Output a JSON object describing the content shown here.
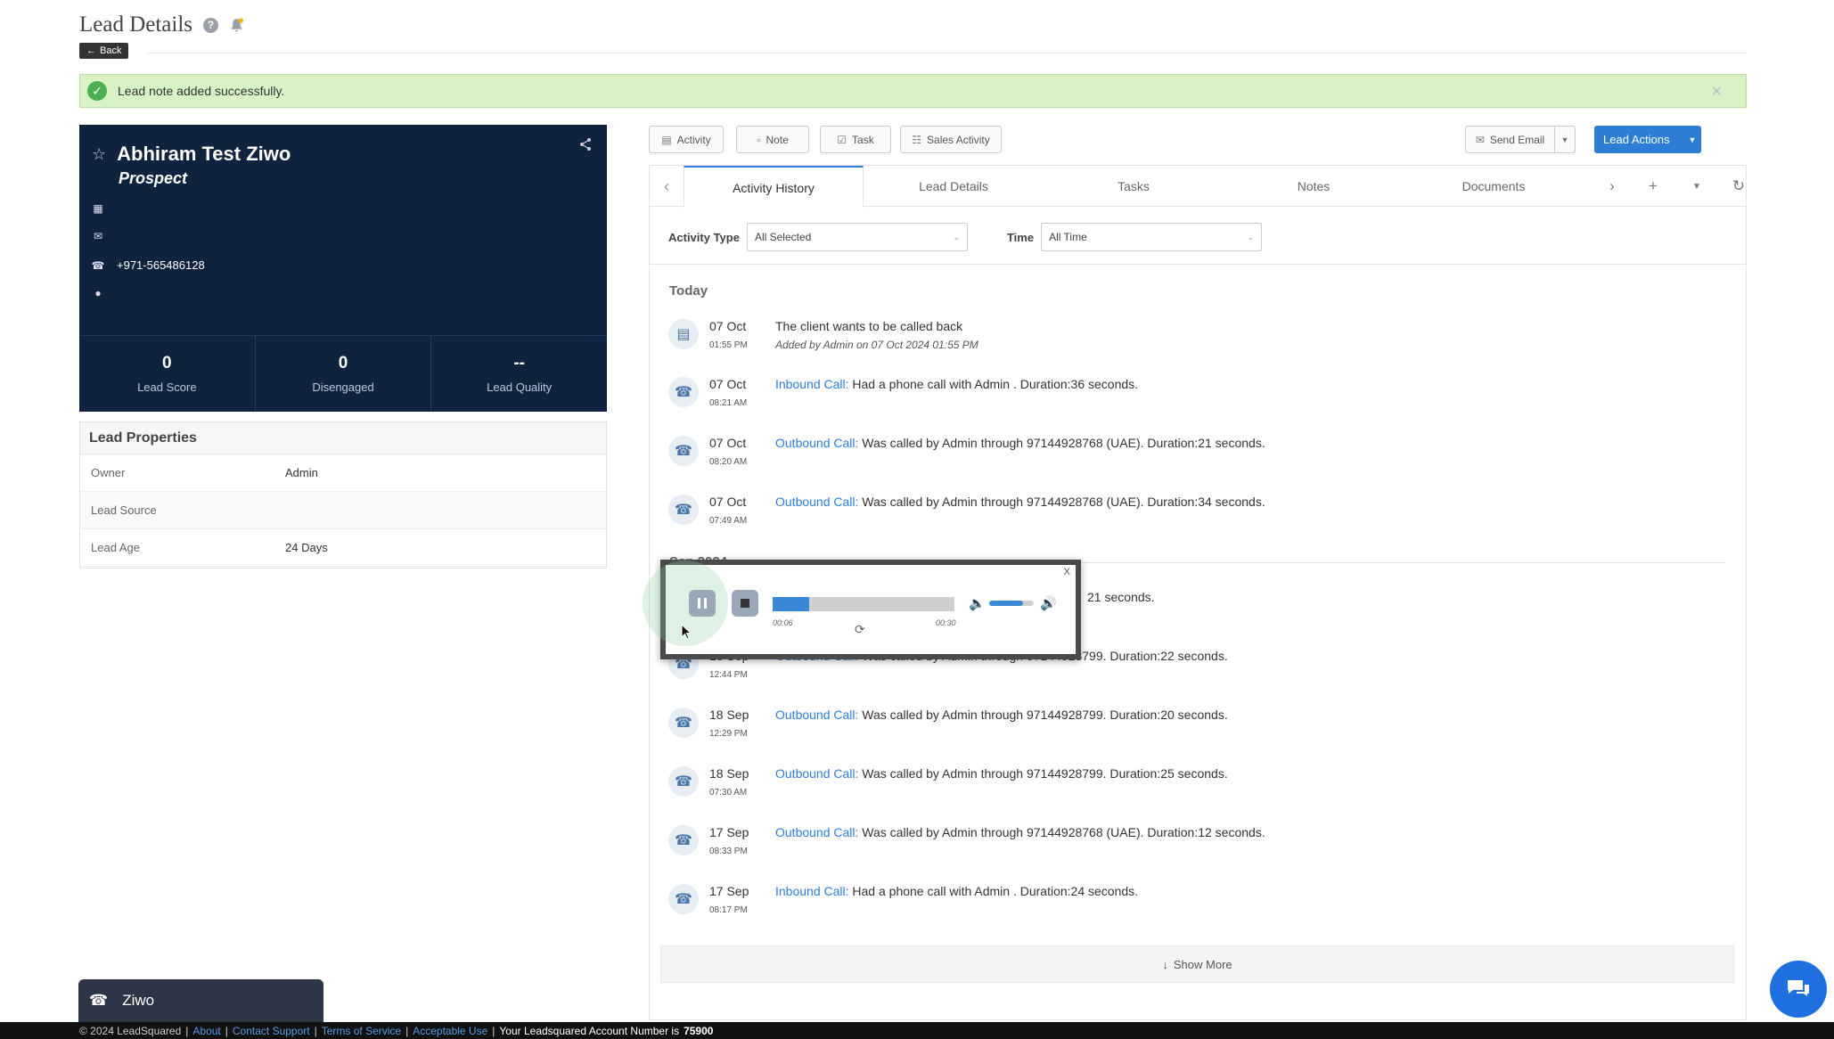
{
  "header": {
    "title": "Lead Details",
    "back_label": "Back"
  },
  "alert": {
    "message": "Lead note added successfully."
  },
  "lead": {
    "name": "Abhiram Test Ziwo",
    "status": "Prospect",
    "phone": "+971-565486128",
    "stats": [
      {
        "value": "0",
        "label": "Lead Score"
      },
      {
        "value": "0",
        "label": "Disengaged"
      },
      {
        "value": "--",
        "label": "Lead Quality"
      }
    ]
  },
  "properties": {
    "title": "Lead Properties",
    "rows": [
      {
        "key": "Owner",
        "value": "Admin"
      },
      {
        "key": "Lead Source",
        "value": ""
      },
      {
        "key": "Lead Age",
        "value": "24 Days"
      }
    ]
  },
  "toolbar": {
    "activity": "Activity",
    "note": "Note",
    "task": "Task",
    "sales_activity": "Sales Activity",
    "send_email": "Send Email",
    "lead_actions": "Lead Actions"
  },
  "tabs": [
    "Activity History",
    "Lead Details",
    "Tasks",
    "Notes",
    "Documents"
  ],
  "filters": {
    "activity_type_label": "Activity Type",
    "activity_type_value": "All Selected",
    "time_label": "Time",
    "time_value": "All Time"
  },
  "groups": {
    "today": "Today",
    "sep": "Sep 2024"
  },
  "activities": [
    {
      "date": "07 Oct",
      "time": "01:55 PM",
      "type": "",
      "text": "The client wants to be called back",
      "sub_prefix": "Added by",
      "sub_user": "Admin",
      "sub_on": "on",
      "sub_when": "07 Oct 2024 01:55 PM"
    },
    {
      "date": "07 Oct",
      "time": "08:21 AM",
      "type": "Inbound Call:",
      "text": "Had a phone call with Admin . Duration:36 seconds."
    },
    {
      "date": "07 Oct",
      "time": "08:20 AM",
      "type": "Outbound Call:",
      "text": "Was called by Admin through 97144928768 (UAE). Duration:21 seconds."
    },
    {
      "date": "07 Oct",
      "time": "07:49 AM",
      "type": "Outbound Call:",
      "text": "Was called by Admin through 97144928768 (UAE). Duration:34 seconds."
    },
    {
      "date": "",
      "time": "",
      "type": "",
      "text": "21 seconds."
    },
    {
      "date": "18 Sep",
      "time": "12:44 PM",
      "type": "Outbound Call:",
      "text": "Was called by Admin through 97144928799. Duration:22 seconds."
    },
    {
      "date": "18 Sep",
      "time": "12:29 PM",
      "type": "Outbound Call:",
      "text": "Was called by Admin through 97144928799. Duration:20 seconds."
    },
    {
      "date": "18 Sep",
      "time": "07:30 AM",
      "type": "Outbound Call:",
      "text": "Was called by Admin through 97144928799. Duration:25 seconds."
    },
    {
      "date": "17 Sep",
      "time": "08:33 PM",
      "type": "Outbound Call:",
      "text": "Was called by Admin through 97144928768 (UAE). Duration:12 seconds."
    },
    {
      "date": "17 Sep",
      "time": "08:17 PM",
      "type": "Inbound Call:",
      "text": "Had a phone call with Admin . Duration:24 seconds."
    }
  ],
  "show_more": "Show More",
  "player": {
    "close": "X",
    "elapsed": "00:06",
    "duration": "00:30",
    "progress_pct": 20,
    "volume_pct": 75
  },
  "ziwo": {
    "label": "Ziwo"
  },
  "footer": {
    "copyright": "© 2024 LeadSquared",
    "links": [
      "About",
      "Contact Support",
      "Terms of Service",
      "Acceptable Use"
    ],
    "account_text": "Your Leadsquared Account Number is",
    "account_number": "75900"
  },
  "colors": {
    "accent": "#2e7ed7",
    "card_bg": "#10233e",
    "success_bg": "#d8f2c6"
  }
}
